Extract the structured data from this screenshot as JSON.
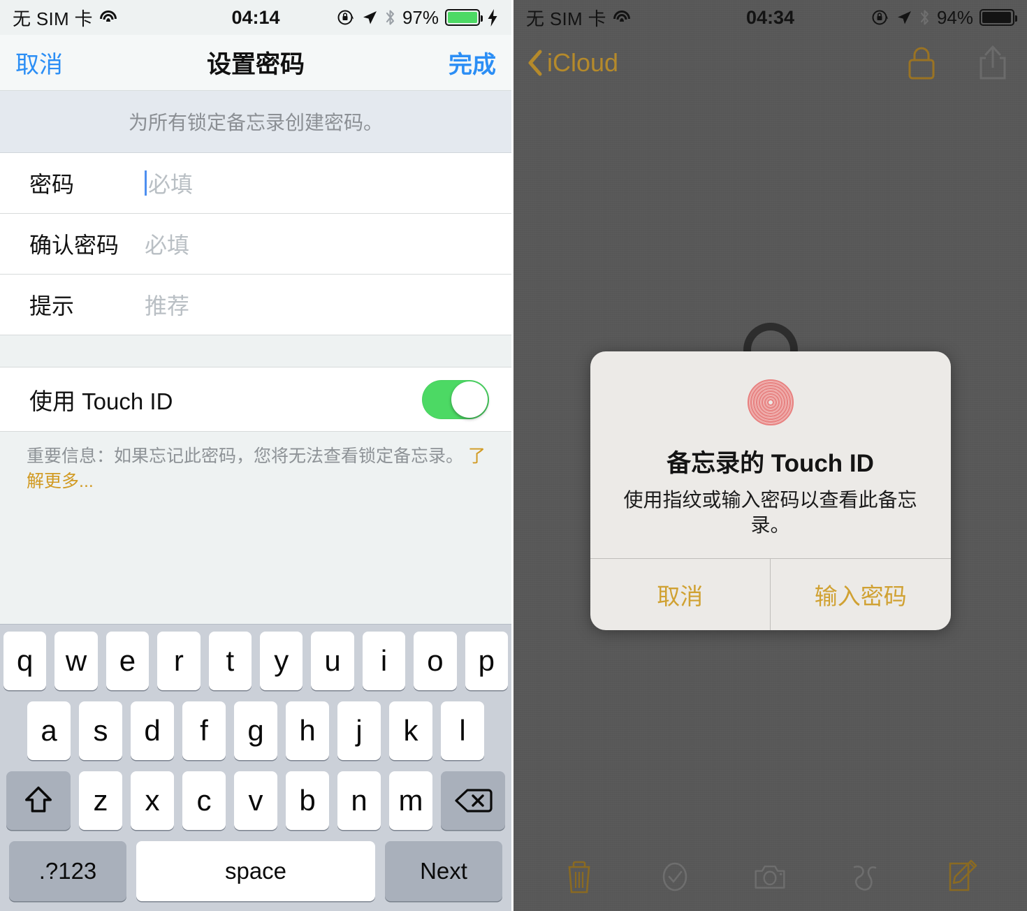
{
  "left": {
    "status_bar": {
      "carrier": "无 SIM 卡",
      "wifi_icon": "wifi-icon",
      "time": "04:14",
      "rotation_lock_icon": "rotation-lock-icon",
      "location_icon": "location-arrow-icon",
      "bluetooth_icon": "bluetooth-icon",
      "battery_percent": "97%",
      "battery_color": "#4cd964",
      "charging_icon": "charging-bolt-icon"
    },
    "nav": {
      "cancel_label": "取消",
      "title": "设置密码",
      "done_label": "完成"
    },
    "section_note": "为所有锁定备忘录创建密码。",
    "fields": [
      {
        "label": "密码",
        "placeholder": "必填",
        "value": "",
        "focused": true
      },
      {
        "label": "确认密码",
        "placeholder": "必填",
        "value": "",
        "focused": false
      },
      {
        "label": "提示",
        "placeholder": "推荐",
        "value": "",
        "focused": false
      }
    ],
    "touch_id": {
      "label": "使用 Touch ID",
      "enabled": true,
      "on_color": "#4cd964"
    },
    "footer_note": {
      "text": "重要信息：如果忘记此密码，您将无法查看锁定备忘录。 ",
      "link_text": "了解更多...",
      "link_color": "#d19a22"
    },
    "keyboard": {
      "row1": [
        "q",
        "w",
        "e",
        "r",
        "t",
        "y",
        "u",
        "i",
        "o",
        "p"
      ],
      "row2": [
        "a",
        "s",
        "d",
        "f",
        "g",
        "h",
        "j",
        "k",
        "l"
      ],
      "row3": [
        "z",
        "x",
        "c",
        "v",
        "b",
        "n",
        "m"
      ],
      "shift_icon": "shift-icon",
      "backspace_icon": "backspace-icon",
      "numeric_label": ".?123",
      "space_label": "space",
      "return_label": "Next"
    }
  },
  "right": {
    "status_bar": {
      "carrier": "无 SIM 卡",
      "wifi_icon": "wifi-icon",
      "time": "04:34",
      "rotation_lock_icon": "rotation-lock-icon",
      "location_icon": "location-arrow-icon",
      "bluetooth_icon": "bluetooth-icon",
      "battery_percent": "94%",
      "battery_color": "#131313",
      "charging_icon": ""
    },
    "nav": {
      "back_label": "iCloud",
      "back_icon": "chevron-left-icon",
      "lock_icon": "lock-icon",
      "share_icon": "share-icon",
      "tint_color": "#b58a2b"
    },
    "dialog": {
      "fingerprint_icon": "fingerprint-icon",
      "fingerprint_color": "#e8807f",
      "title": "备忘录的 Touch ID",
      "message": "使用指纹或输入密码以查看此备忘录。",
      "cancel_label": "取消",
      "password_label": "输入密码",
      "button_color": "#d0a132"
    },
    "toolbar": [
      {
        "icon": "trash-icon",
        "active": true
      },
      {
        "icon": "checkmark-circle-icon",
        "active": false
      },
      {
        "icon": "camera-icon",
        "active": false
      },
      {
        "icon": "squiggle-sketch-icon",
        "active": false
      },
      {
        "icon": "compose-icon",
        "active": true
      }
    ]
  }
}
